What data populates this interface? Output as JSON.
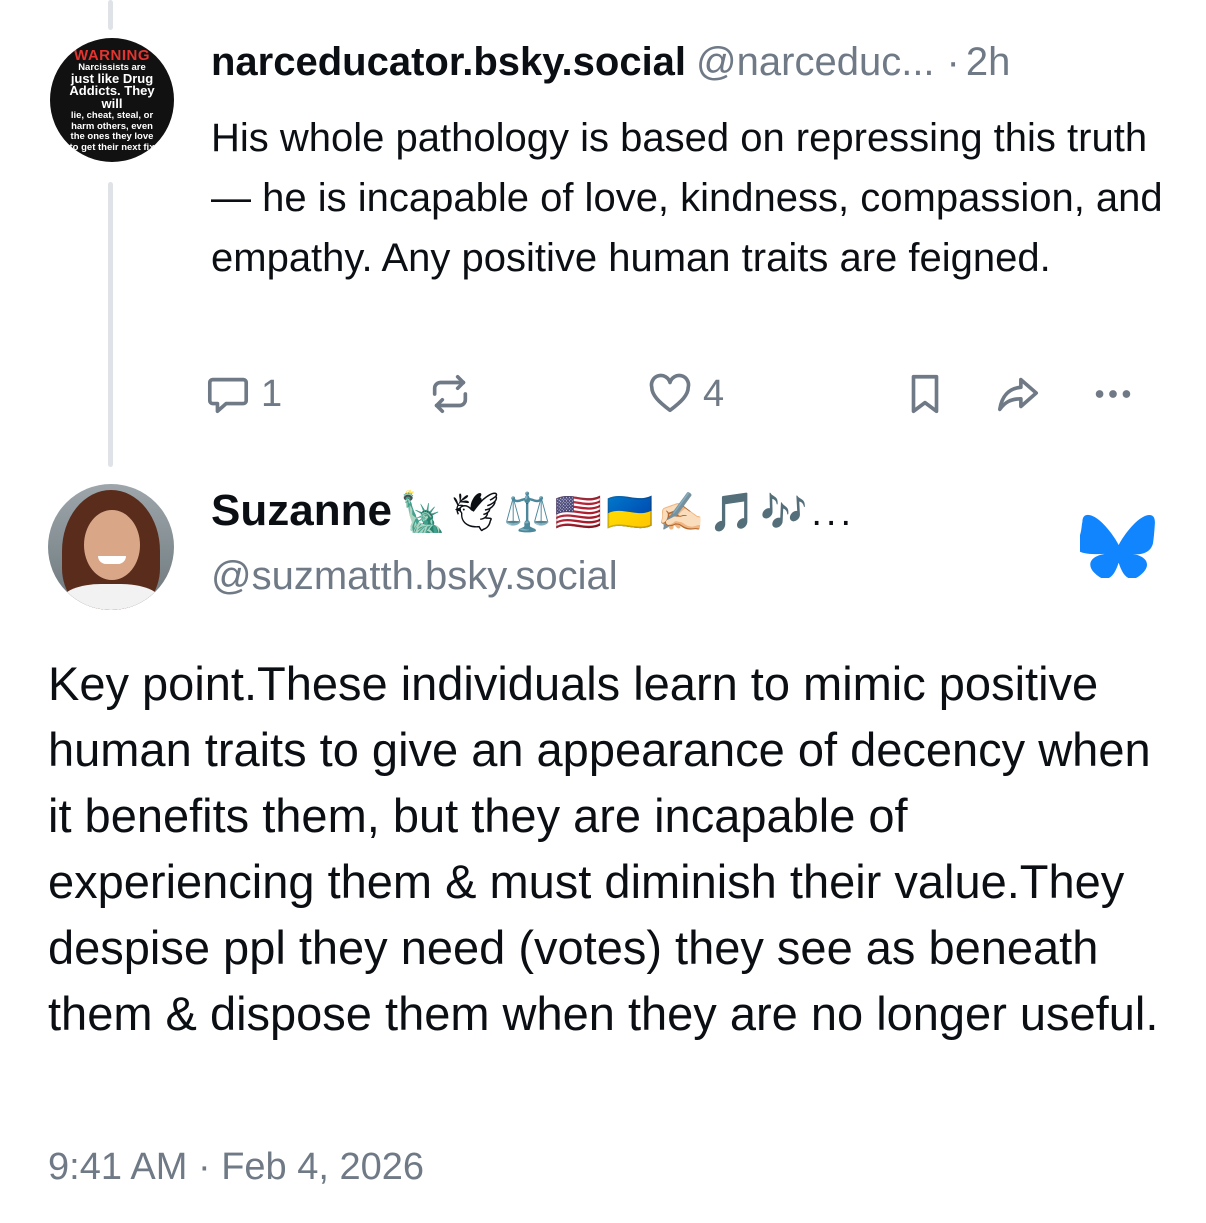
{
  "parent_post": {
    "avatar": {
      "title": "WARNING",
      "lines": [
        "Narcissists are",
        "just like Drug",
        "Addicts. They will",
        "lie, cheat, steal, or",
        "harm others, even",
        "the ones they love",
        "to get their next fix"
      ]
    },
    "display_name": "narceducator.bsky.social",
    "handle": "@narceduc...",
    "separator": "·",
    "time": "2h",
    "text": "His whole pathology is based on repressing this truth — he is incapable of love, kindness, compassion, and empathy. Any positive human traits are feigned.",
    "actions": {
      "reply_count": "1",
      "repost_count": "",
      "like_count": "4"
    }
  },
  "reply_post": {
    "display_name": "Suzanne",
    "name_emojis": "🗽🕊⚖️🇺🇸🇺🇦✍🏻🎵🎶...",
    "handle": "@suzmatth.bsky.social",
    "text": "Key point.These individuals learn to mimic positive human traits to give an appearance of decency when it benefits them, but they are incapable of experiencing them & must diminish their value.They despise ppl they need (votes) they see as beneath them & dispose them when they are no longer useful.",
    "timestamp": "9:41 AM · Feb 4, 2026"
  },
  "colors": {
    "accent_blue": "#1185fe",
    "muted_text": "#6f7a86",
    "thread_line": "#dfe3e8"
  },
  "icons": [
    "reply-icon",
    "repost-icon",
    "like-icon",
    "bookmark-icon",
    "share-icon",
    "more-icon",
    "bluesky-butterfly-icon"
  ]
}
